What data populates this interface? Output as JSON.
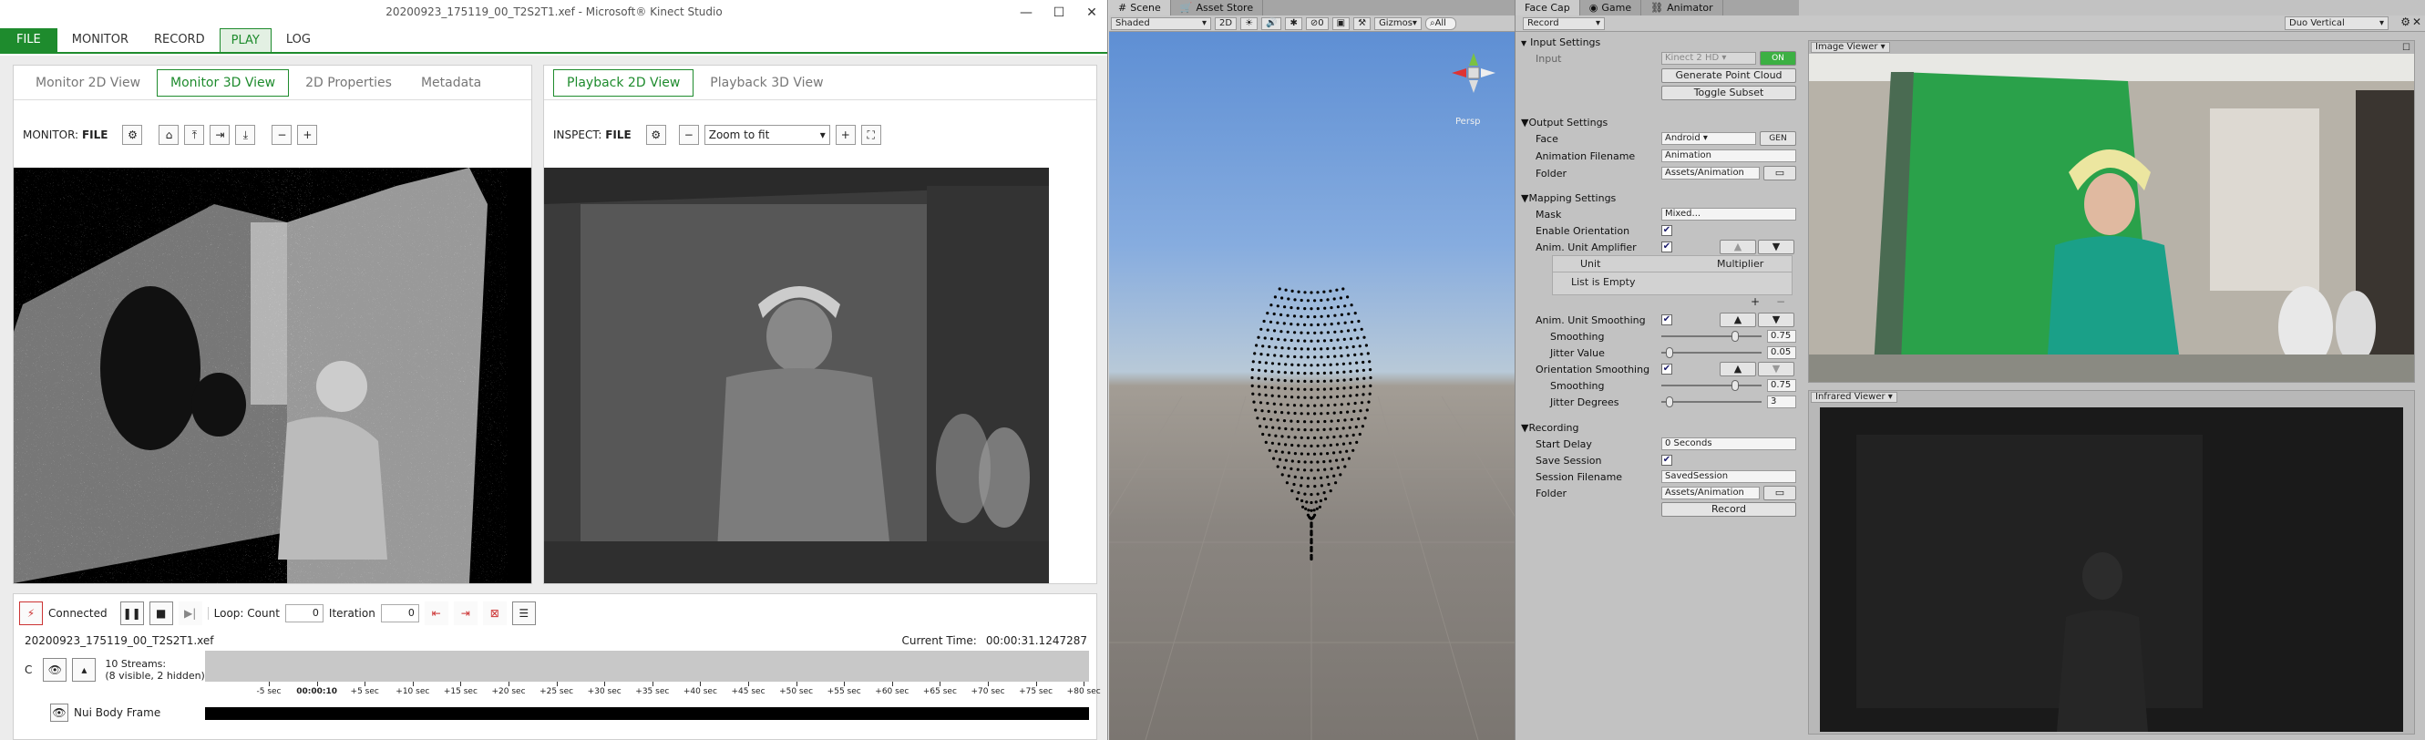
{
  "kinect": {
    "title": "20200923_175119_00_T2S2T1.xef - Microsoft® Kinect Studio",
    "menu": [
      "FILE",
      "MONITOR",
      "RECORD",
      "PLAY",
      "LOG"
    ],
    "active_menu": "PLAY",
    "left_panel": {
      "tabs": [
        "Monitor 2D View",
        "Monitor 3D View",
        "2D Properties",
        "Metadata"
      ],
      "active_tab": "Monitor 3D View",
      "monitor_label": "MONITOR:",
      "monitor_value": "FILE"
    },
    "right_panel": {
      "tabs": [
        "Playback 2D View",
        "Playback 3D View"
      ],
      "active_tab": "Playback 2D View",
      "inspect_label": "INSPECT:",
      "inspect_value": "FILE",
      "zoom_value": "Zoom to fit"
    },
    "timeline": {
      "connected": "Connected",
      "loop_label": "Loop: Count",
      "loop_count": "0",
      "iteration_label": "Iteration",
      "iteration_value": "0",
      "filename": "20200923_175119_00_T2S2T1.xef",
      "current_time_label": "Current Time:",
      "current_time": "00:00:31.1247287",
      "streams_c": "C",
      "streams_title": "10 Streams:",
      "streams_sub": "(8 visible, 2 hidden)",
      "ticks": [
        "-5 sec",
        "00:00:10",
        "+5 sec",
        "+10 sec",
        "+15 sec",
        "+20 sec",
        "+25 sec",
        "+30 sec",
        "+35 sec",
        "+40 sec",
        "+45 sec",
        "+50 sec",
        "+55 sec",
        "+60 sec",
        "+65 sec",
        "+70 sec",
        "+75 sec",
        "+80 sec"
      ],
      "body_frame_label": "Nui Body Frame"
    }
  },
  "scene": {
    "tabs": [
      "Scene",
      "Asset Store"
    ],
    "shading": "Shaded",
    "mode_2d": "2D",
    "gizmo_count": "0",
    "gizmos": "Gizmos",
    "search": "All",
    "persp": "Persp"
  },
  "inspector": {
    "tabs": [
      "Face Cap",
      "Game",
      "Animator"
    ],
    "mode": "Record",
    "input_settings": "Input Settings",
    "input_label": "Input",
    "input_value": "Kinect 2 HD",
    "on_label": "ON",
    "generate_point_cloud": "Generate Point Cloud",
    "toggle_subset": "Toggle Subset",
    "output_settings": "Output Settings",
    "face_label": "Face",
    "face_value": "Android",
    "gen_label": "GEN",
    "anim_filename_label": "Animation Filename",
    "anim_filename_value": "Animation",
    "folder_label": "Folder",
    "folder_value": "Assets/Animation",
    "mapping_settings": "Mapping Settings",
    "mask_label": "Mask",
    "mask_value": "Mixed...",
    "enable_orientation_label": "Enable Orientation",
    "anim_unit_amplifier_label": "Anim. Unit Amplifier",
    "unit_col": "Unit",
    "multiplier_col": "Multiplier",
    "list_empty": "List is Empty",
    "anim_unit_smoothing_label": "Anim. Unit Smoothing",
    "smoothing_label": "Smoothing",
    "smoothing_value": "0.75",
    "smoothing_level": 0.75,
    "jitter_value_label": "Jitter Value",
    "jitter_value": "0.05",
    "jitter_level": 0.05,
    "orientation_smoothing_label": "Orientation Smoothing",
    "orient_smoothing_value": "0.75",
    "orient_smoothing_level": 0.75,
    "jitter_degrees_label": "Jitter Degrees",
    "jitter_degrees_value": "3",
    "jitter_degrees_level": 0.05,
    "recording": "Recording",
    "start_delay_label": "Start Delay",
    "start_delay_value": "0 Seconds",
    "save_session_label": "Save Session",
    "session_filename_label": "Session Filename",
    "session_filename_value": "SavedSession",
    "folder2_value": "Assets/Animation",
    "record_button": "Record"
  },
  "viewers": {
    "layout": "Duo Vertical",
    "image_viewer": "Image Viewer",
    "infrared_viewer": "Infrared Viewer"
  }
}
